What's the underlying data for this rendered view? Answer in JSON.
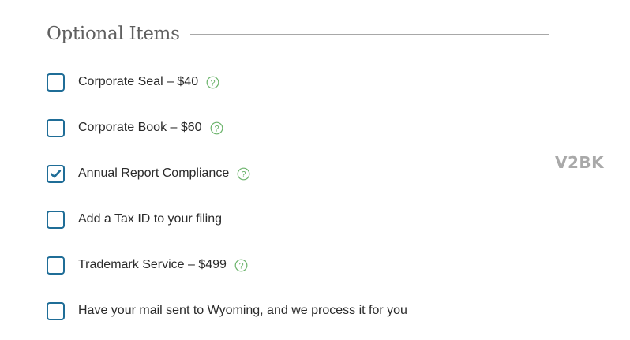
{
  "section": {
    "title": "Optional Items"
  },
  "options": [
    {
      "label": "Corporate Seal – $40",
      "checked": false,
      "has_help": true
    },
    {
      "label": "Corporate Book – $60",
      "checked": false,
      "has_help": true
    },
    {
      "label": "Annual Report Compliance",
      "checked": true,
      "has_help": true
    },
    {
      "label": "Add a Tax ID to your filing",
      "checked": false,
      "has_help": false
    },
    {
      "label": "Trademark Service – $499",
      "checked": false,
      "has_help": true
    },
    {
      "label": "Have your mail sent to Wyoming, and we process it for you",
      "checked": false,
      "has_help": false
    }
  ],
  "watermark": {
    "text": "V2BK"
  },
  "colors": {
    "checkbox_border": "#1f6d97",
    "help_icon": "#6ab36a",
    "title": "#5f5f5f"
  },
  "icons": {
    "help": "question-circle-icon",
    "check": "checkmark-icon"
  }
}
